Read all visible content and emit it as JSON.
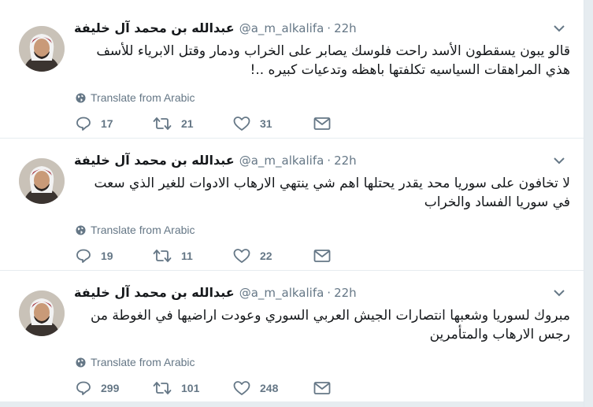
{
  "tweets": [
    {
      "author_name": "عبدالله بن محمد آل خليفة",
      "handle": "@a_m_alkalifa",
      "separator": "·",
      "time": "22h",
      "text": "قالو يبون يسقطون الأسد راحت فلوسك يصابر على الخراب ودمار وقتل الابرياء للأسف هذي المراهقات السياسيه تكلفتها باهظه وتدعيات كبيره ..!",
      "translate_label": "Translate from Arabic",
      "replies": "17",
      "retweets": "21",
      "likes": "31"
    },
    {
      "author_name": "عبدالله بن محمد آل خليفة",
      "handle": "@a_m_alkalifa",
      "separator": "·",
      "time": "22h",
      "text": "لا تخافون على سوريا محد يقدر يحتلها اهم شي ينتهي الارهاب الادوات للغير الذي سعت في سوريا الفساد والخراب",
      "translate_label": "Translate from Arabic",
      "replies": "19",
      "retweets": "11",
      "likes": "22"
    },
    {
      "author_name": "عبدالله بن محمد آل خليفة",
      "handle": "@a_m_alkalifa",
      "separator": "·",
      "time": "22h",
      "text": "مبروك لسوريا وشعبها انتصارات الجيش العربي السوري وعودت اراضيها في الغوطة من رجس الارهاب والمتأمرين",
      "translate_label": "Translate from Arabic",
      "replies": "299",
      "retweets": "101",
      "likes": "248"
    }
  ],
  "icons": {
    "caret": "chevron-down-icon",
    "globe": "globe-icon",
    "reply": "reply-icon",
    "retweet": "retweet-icon",
    "like": "heart-icon",
    "dm": "envelope-icon"
  },
  "colors": {
    "text": "#14171a",
    "secondary": "#657786",
    "divider": "#e6ecf0",
    "background": "#ffffff"
  }
}
